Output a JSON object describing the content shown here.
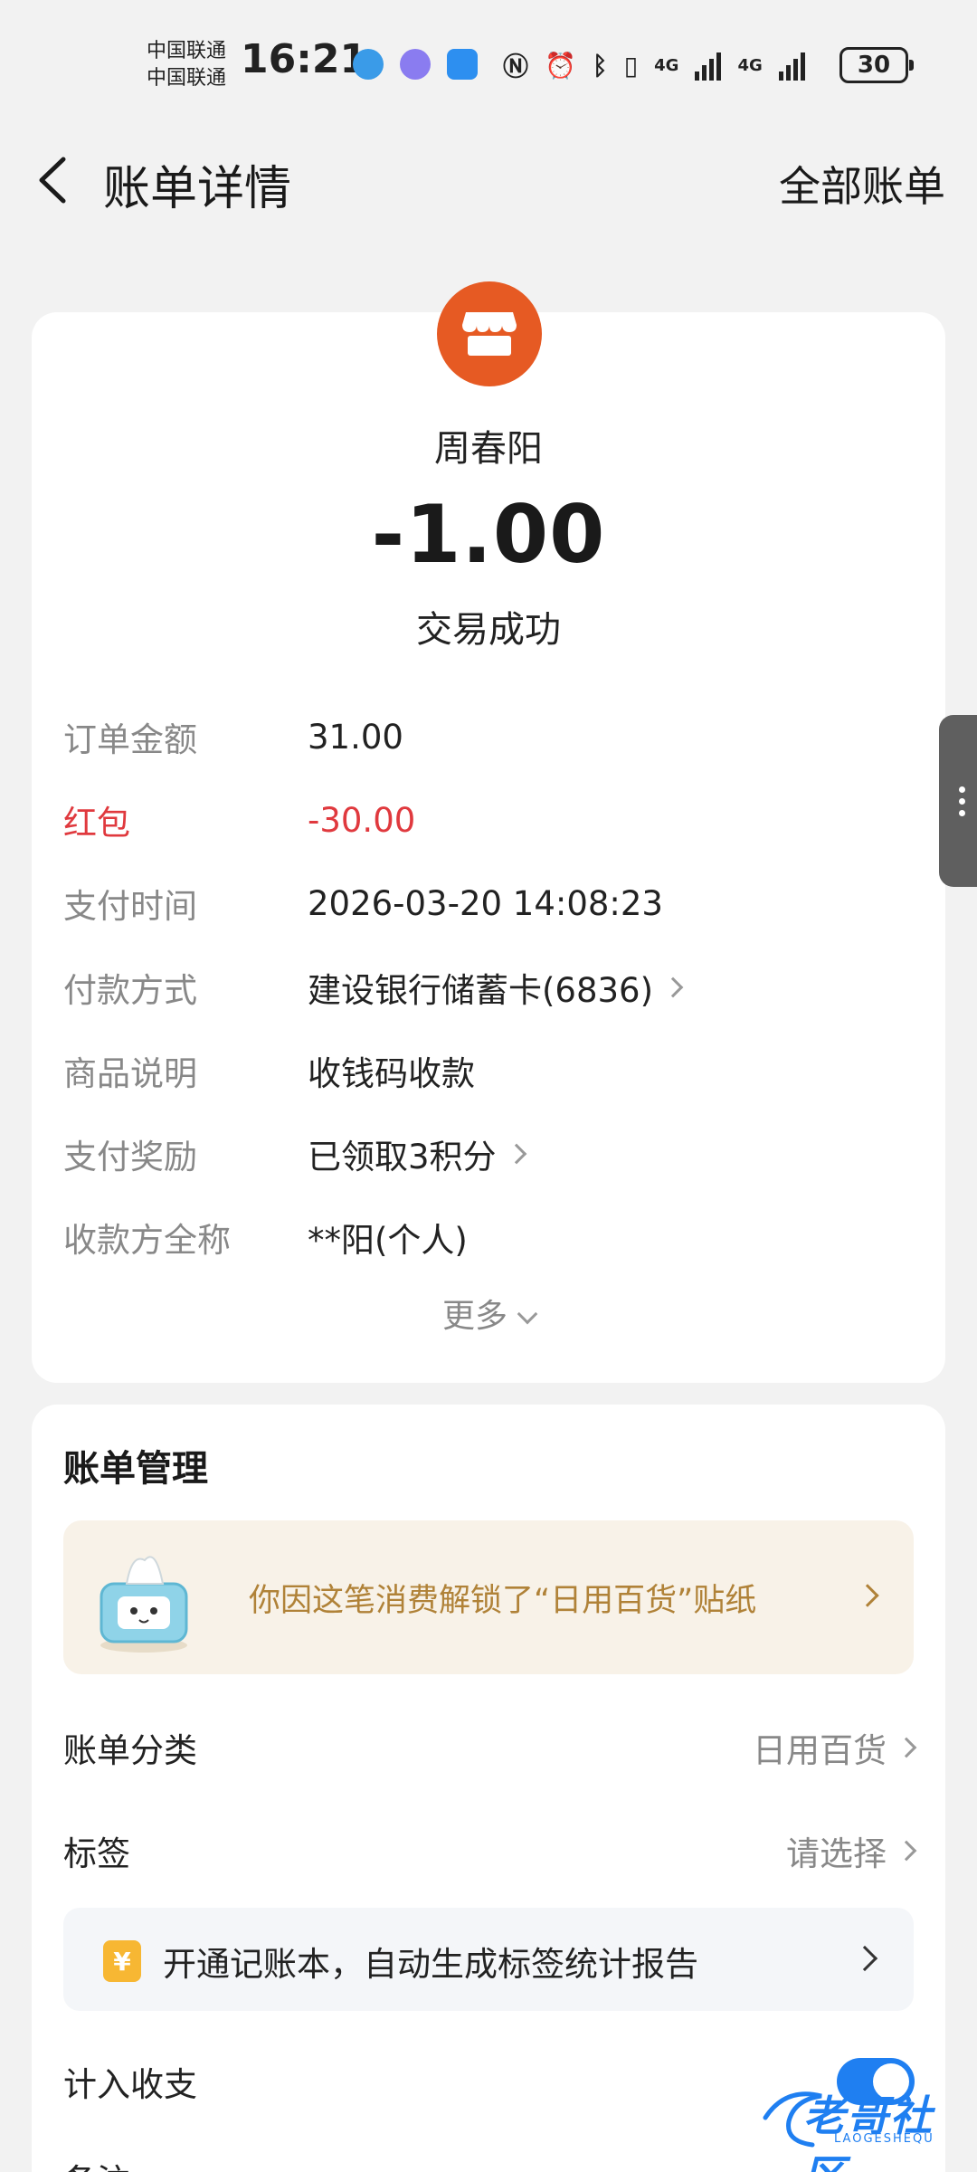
{
  "status_bar": {
    "carrier1": "中国联通",
    "carrier2": "中国联通",
    "time": "16:21",
    "network1": "4G",
    "network2": "4G",
    "battery": "30",
    "icons": [
      "browser-icon",
      "music-icon",
      "weather-icon",
      "nfc-icon",
      "alarm-icon",
      "bluetooth-icon",
      "vibrate-icon"
    ]
  },
  "header": {
    "title": "账单详情",
    "right_link": "全部账单"
  },
  "bill": {
    "merchant": "周春阳",
    "amount": "-1.00",
    "status": "交易成功",
    "details": [
      {
        "label": "订单金额",
        "value": "31.00"
      },
      {
        "label": "红包",
        "value": "-30.00"
      },
      {
        "label": "支付时间",
        "value": "2026-03-20 14:08:23"
      },
      {
        "label": "付款方式",
        "value": "建设银行储蓄卡(6836)"
      },
      {
        "label": "商品说明",
        "value": "收钱码收款"
      },
      {
        "label": "支付奖励",
        "value": "已领取3积分"
      },
      {
        "label": "收款方全称",
        "value": "**阳(个人)"
      }
    ],
    "more": "更多"
  },
  "manage": {
    "title": "账单管理",
    "sticker_text": "你因这笔消费解锁了“日用百货”贴纸",
    "category_label": "账单分类",
    "category_value": "日用百货",
    "tag_label": "标签",
    "tag_value": "请选择",
    "ledger_icon": "¥",
    "ledger_text": "开通记账本，自动生成标签统计报告",
    "income_label": "计入收支",
    "income_enabled": true,
    "note_label": "备注"
  },
  "watermark": {
    "text": "老哥社区",
    "sub": "LAOGESHEQU"
  },
  "colors": {
    "accent": "#1f7ff1",
    "merchant_logo": "#e65a23",
    "negative": "#e0393e",
    "sticker_text": "#b08238"
  }
}
